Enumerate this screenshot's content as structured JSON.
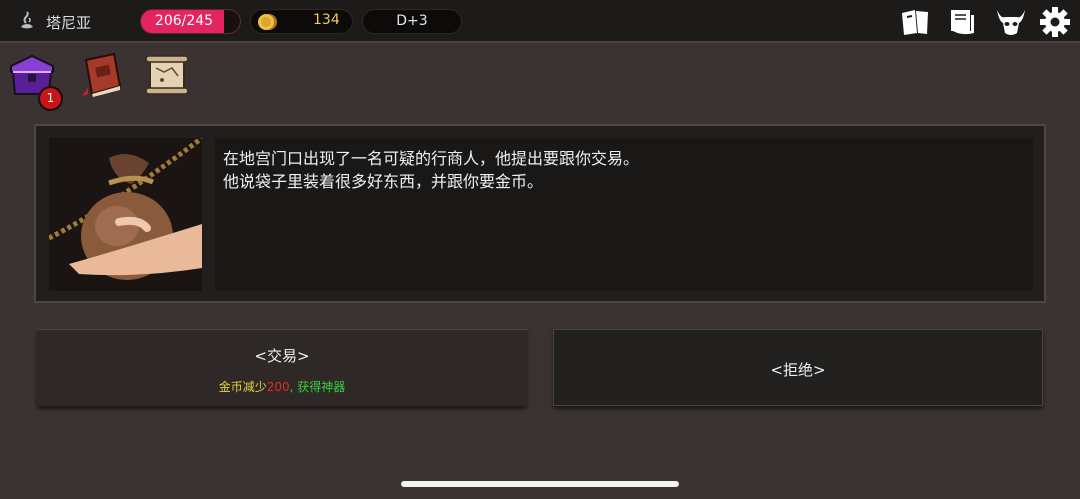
{
  "topbar": {
    "region_icon": "smoke-icon",
    "region_name": "塔尼亚",
    "hp": {
      "current": 206,
      "max": 245,
      "text": "206/245",
      "color": "#e3245f"
    },
    "gold": {
      "icon": "coin-icon",
      "value": "134",
      "color": "#f2c95a"
    },
    "day": "D+3",
    "right_icons": [
      "cards-icon",
      "scroll-book-icon",
      "demon-mask-icon",
      "gear-icon"
    ]
  },
  "inventory": {
    "items": [
      "purple-chest-icon",
      "red-spellbook-icon",
      "map-scroll-icon"
    ],
    "chest_badge": "1"
  },
  "event": {
    "image": "money-bag-icon",
    "lines": [
      "在地宫门口出现了一名可疑的行商人，他提出要跟你交易。",
      "他说袋子里装着很多好东西，并跟你要金币。"
    ]
  },
  "choices": {
    "trade": {
      "label": "<交易>",
      "sub_part1": "金币减少",
      "sub_amount": "200",
      "sub_sep": ", ",
      "sub_part2": "获得神器",
      "colors": {
        "part1": "#e6d23c",
        "amount": "#e02a2a",
        "part2": "#3ccd3c"
      }
    },
    "refuse": {
      "label": "<拒绝>"
    }
  }
}
